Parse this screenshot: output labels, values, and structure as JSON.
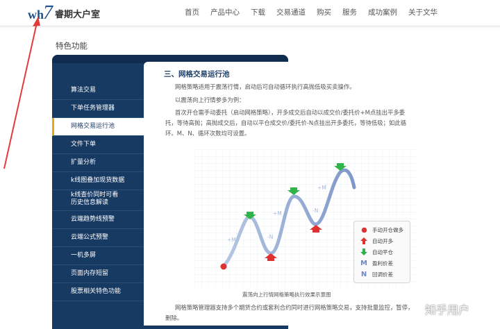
{
  "logo": {
    "wh": "wh",
    "seven": "7",
    "cn": "睿期大户室"
  },
  "nav": [
    "首页",
    "产品中心",
    "下载",
    "交易通道",
    "购买",
    "服务",
    "成功案例",
    "关于文华"
  ],
  "section_title": "特色功能",
  "sidebar": [
    "算法交易",
    "下单任务管理器",
    "网格交易运行池",
    "文件下单",
    "扩量分析",
    "k线图叠加现货数据",
    "k线查价同时可看",
    "历史信息解读",
    "云端趋势线预警",
    "云端公式预警",
    "一机多屏",
    "页面内存短留",
    "股票相关特色功能"
  ],
  "content": {
    "title": "三、网格交易运行池",
    "p1": "网格策略适用于震荡行情，启动后可自动循环执行高抛低吸买卖操作。",
    "p2": "以震荡向上行情参多为例：",
    "p3a": "首次开仓需手动委托（启动网格策略），开多成交后自动以成交价/委托价+M点挂出平多委",
    "p3b": "托，等待高抛；高抛成交后，自动以平仓成交价/委托价-N点挂出开多委托，等待低吸；如此循",
    "p3c": "环。M、N、循环次数均可设置。",
    "caption": "震荡向上行情网格策略执行效果示意图",
    "p4a": "网格策略管理器支持多个期货合约或套利合约同时进行网格策略交易，支持批量监控，暂停，",
    "p4b": "删除。"
  },
  "chart_labels": {
    "m": "+M",
    "n": "-N"
  },
  "legend": [
    {
      "icon": "red-dot-icon",
      "label": "手动开仓做多"
    },
    {
      "icon": "red-up-arrow-icon",
      "label": "自动开多"
    },
    {
      "icon": "green-down-arrow-icon",
      "label": "自动平仓"
    },
    {
      "icon": "letter-m-icon",
      "glyph": "M",
      "label": "盈利价差"
    },
    {
      "icon": "letter-n-icon",
      "glyph": "N",
      "label": "回调价差"
    }
  ],
  "watermark": "知乎用户",
  "colors": {
    "navy": "#173a63",
    "accent": "#e6a817",
    "up": "#e03131",
    "down": "#2fb34a",
    "wave": "#8ea6d2"
  }
}
